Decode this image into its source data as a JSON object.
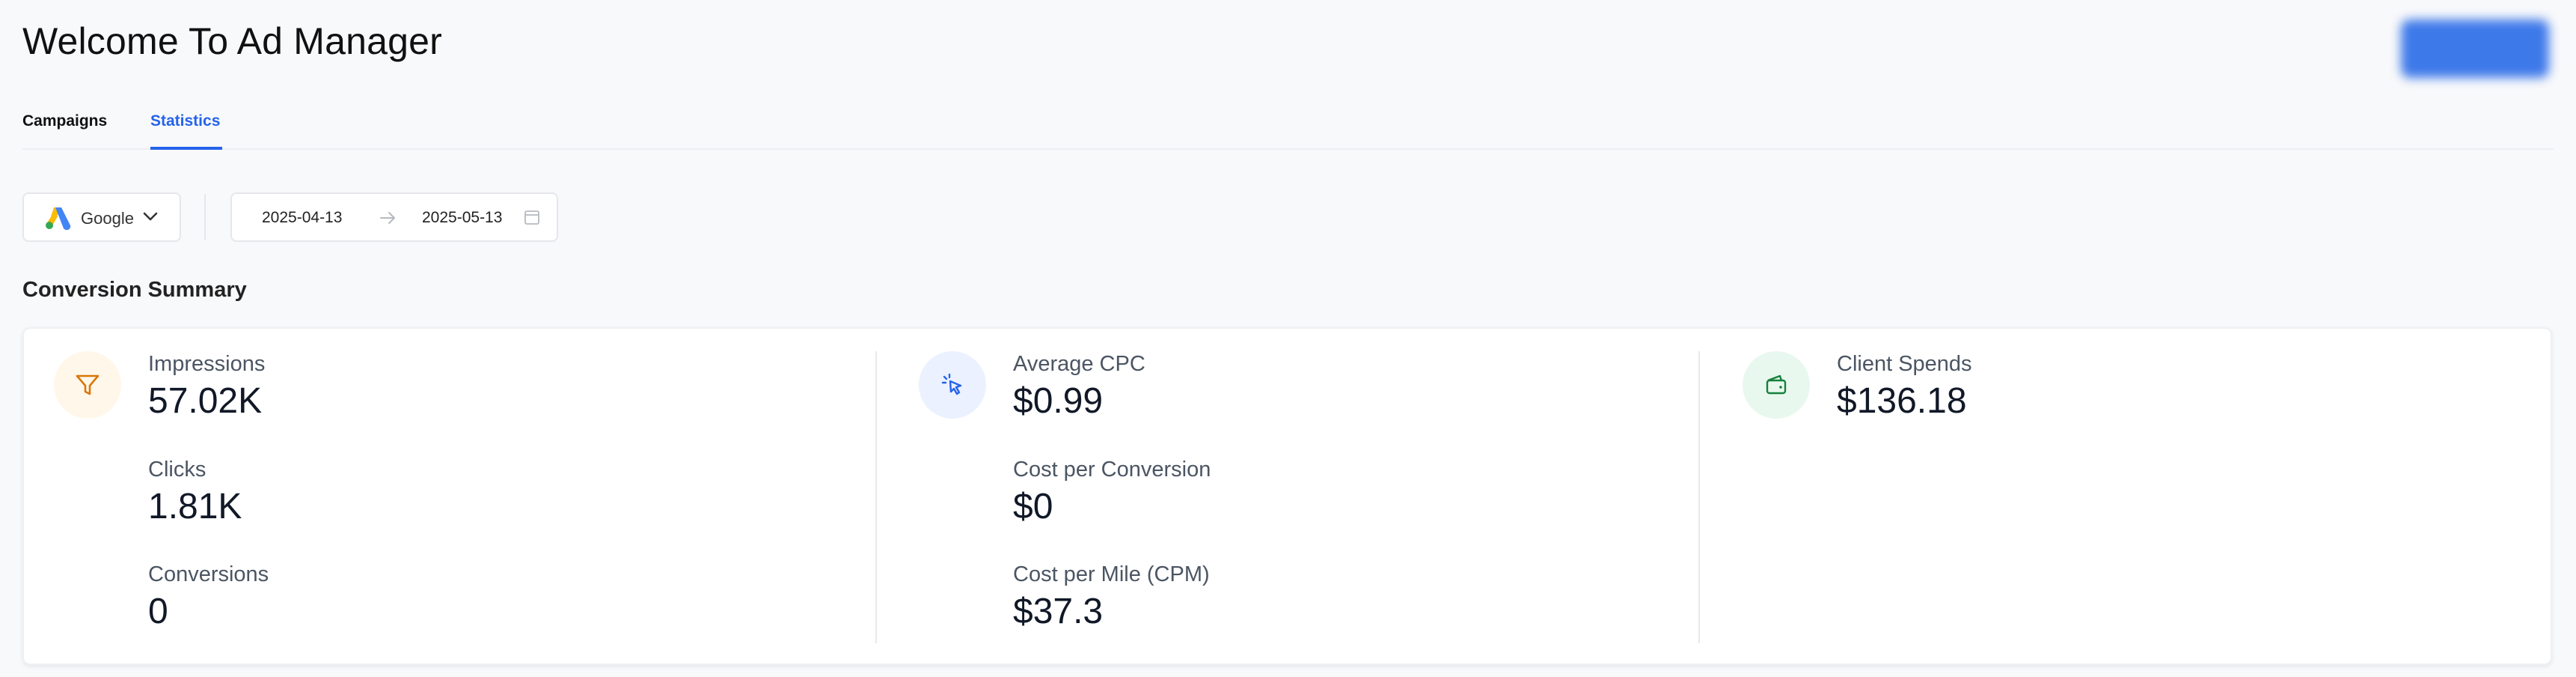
{
  "header": {
    "title": "Welcome To Ad Manager"
  },
  "tabs": [
    {
      "label": "Campaigns",
      "active": false
    },
    {
      "label": "Statistics",
      "active": true
    }
  ],
  "filters": {
    "platform": {
      "selected": "Google",
      "icon": "google-ads-logo-icon"
    },
    "date_range": {
      "start": "2025-04-13",
      "end": "2025-05-13"
    }
  },
  "summary": {
    "title": "Conversion Summary",
    "columns": [
      {
        "icon": "funnel-icon",
        "metrics": [
          {
            "label": "Impressions",
            "value": "57.02K"
          },
          {
            "label": "Clicks",
            "value": "1.81K"
          },
          {
            "label": "Conversions",
            "value": "0"
          }
        ]
      },
      {
        "icon": "cursor-click-icon",
        "metrics": [
          {
            "label": "Average CPC",
            "value": "$0.99"
          },
          {
            "label": "Cost per Conversion",
            "value": "$0"
          },
          {
            "label": "Cost per Mile (CPM)",
            "value": "$37.3"
          }
        ]
      },
      {
        "icon": "wallet-icon",
        "metrics": [
          {
            "label": "Client Spends",
            "value": "$136.18"
          }
        ]
      }
    ]
  },
  "colors": {
    "accent": "#2563eb",
    "funnel": "#d97706",
    "cursor": "#2563eb",
    "wallet": "#15803d"
  }
}
